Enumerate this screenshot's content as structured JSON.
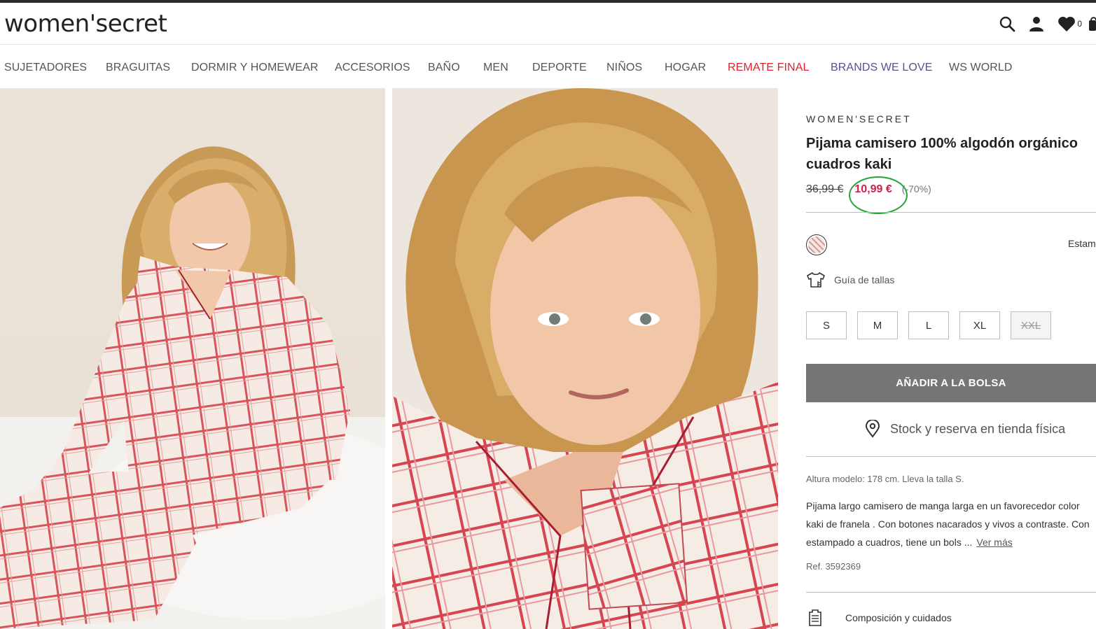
{
  "header": {
    "logo": "women'secret",
    "favorites_count": "0"
  },
  "nav": {
    "items": [
      "SUJETADORES",
      "BRAGUITAS",
      "DORMIR Y HOMEWEAR",
      "ACCESORIOS",
      "BAÑO",
      "MEN",
      "DEPORTE",
      "NIÑOS",
      "HOGAR",
      "REMATE FINAL",
      "BRANDS WE LOVE",
      "WS WORLD"
    ],
    "accent_red": "#e0202c",
    "accent_purple": "#5c4f8e"
  },
  "product": {
    "brand": "WOMEN'SECRET",
    "title": "Pijama camisero 100% algodón orgánico cuadros kaki",
    "price_old": "36,99 €",
    "price_new": "10,99 €",
    "discount": "(-70%)",
    "price_color": "#c8244b",
    "swatch_label": "Estam",
    "size_guide": "Guía de tallas",
    "sizes": [
      "S",
      "M",
      "L",
      "XL",
      "XXL"
    ],
    "unavailable_size": "XXL",
    "add_to_bag": "AÑADIR A LA BOLSA",
    "stock": "Stock y reserva en tienda física",
    "model_info": "Altura modelo: 178 cm.  Lleva la talla S.",
    "description_lines": [
      "Pijama largo camisero de manga larga en un favorecedor color",
      "kaki de franela . Con botones nacarados y vivos a contraste. Con",
      "estampado a cuadros, tiene un bols ..."
    ],
    "see_more": "Ver más",
    "reference": "Ref. 3592369",
    "composition": "Composición y cuidados"
  }
}
